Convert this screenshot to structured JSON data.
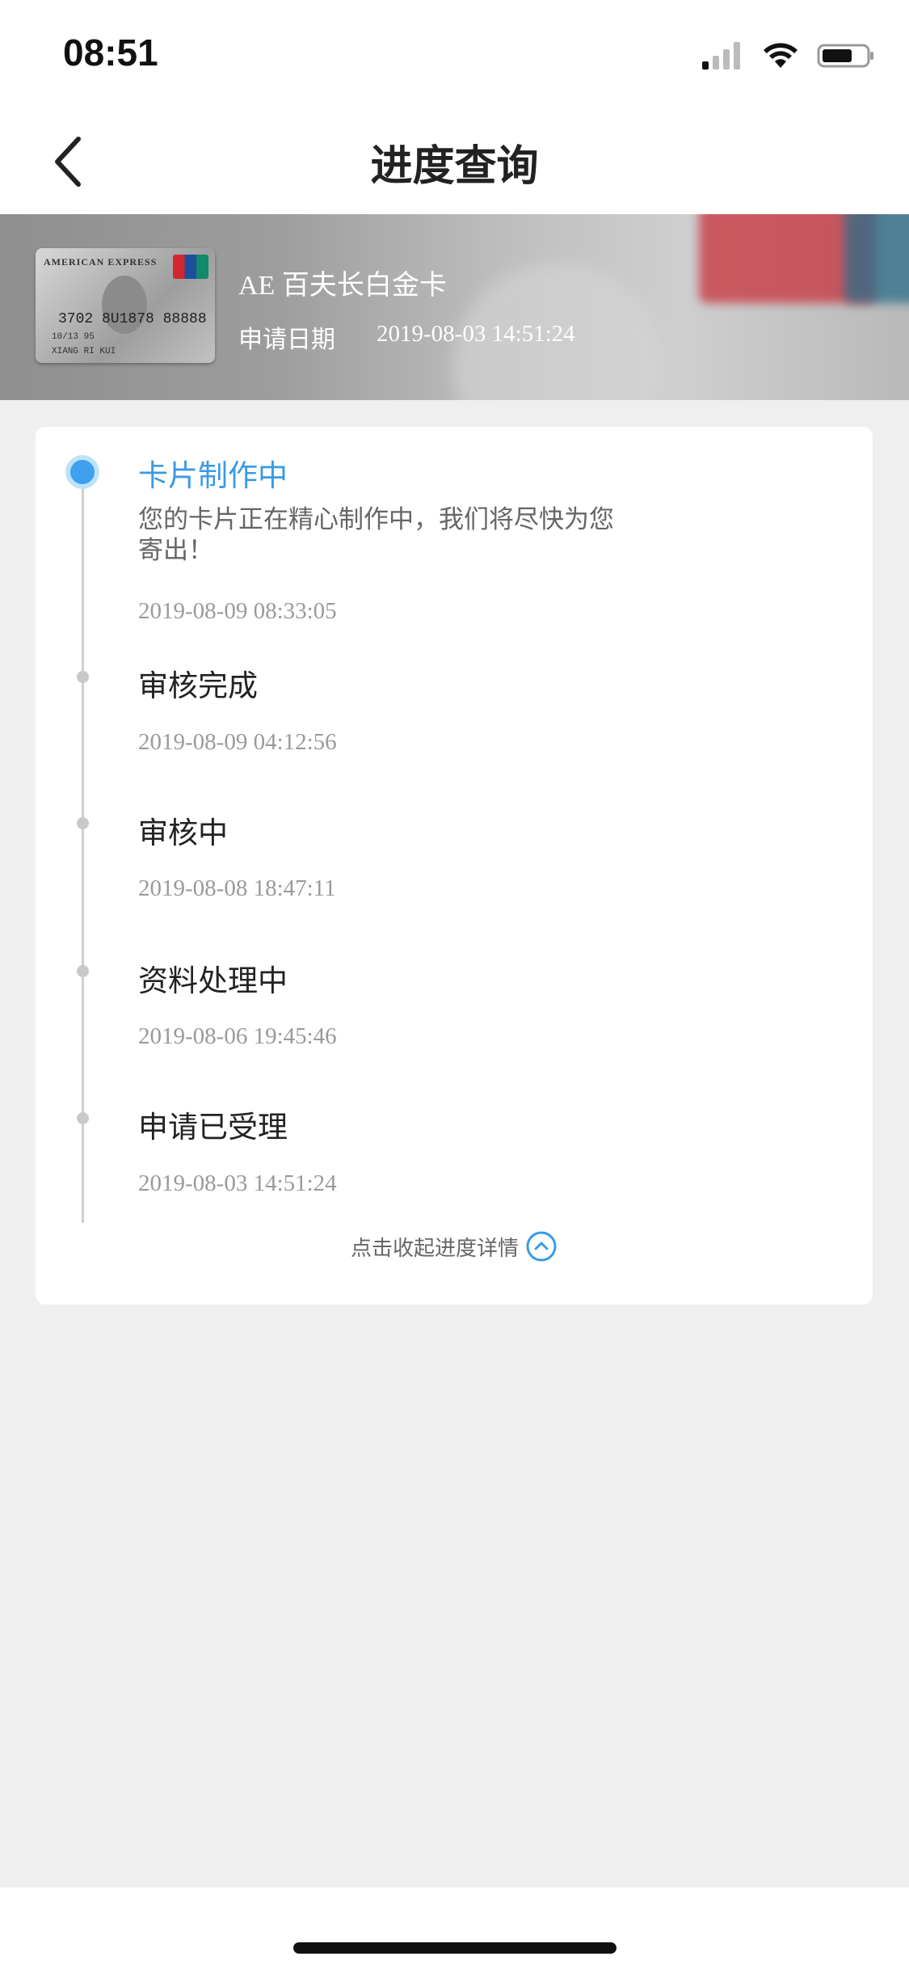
{
  "status_bar": {
    "time": "08:51"
  },
  "nav": {
    "title": "进度查询"
  },
  "card": {
    "brand_text": "AMERICAN EXPRESS",
    "number_text": "3702 8U1878 88888",
    "expiry_text": "10/13     95",
    "holder_text": "XIANG RI KUI",
    "name": "AE 百夫长白金卡",
    "apply_label": "申请日期",
    "apply_date": "2019-08-03 14:51:24"
  },
  "progress": {
    "steps": [
      {
        "title": "卡片制作中",
        "desc": "您的卡片正在精心制作中，我们将尽快为您寄出！",
        "time": "2019-08-09 08:33:05"
      },
      {
        "title": "审核完成",
        "time": "2019-08-09 04:12:56"
      },
      {
        "title": "审核中",
        "time": "2019-08-08 18:47:11"
      },
      {
        "title": "资料处理中",
        "time": "2019-08-06 19:45:46"
      },
      {
        "title": "申请已受理",
        "time": "2019-08-03 14:51:24"
      }
    ],
    "collapse_label": "点击收起进度详情"
  },
  "colors": {
    "accent": "#3a9ae4",
    "background": "#efefef"
  }
}
